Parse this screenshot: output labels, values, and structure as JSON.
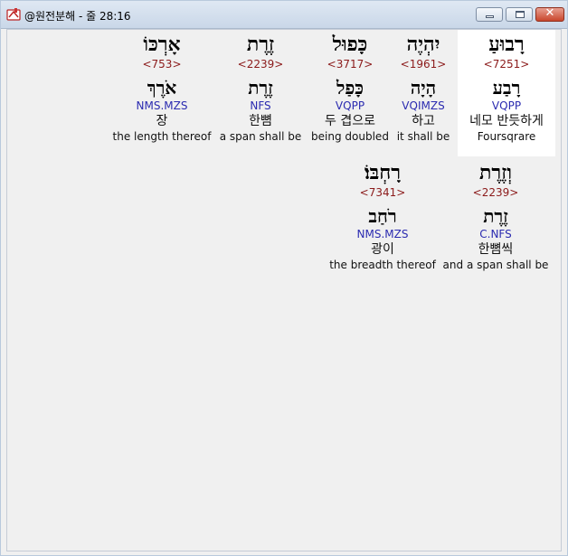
{
  "window": {
    "title": "@원전분해 - 줄 28:16",
    "icon": "app-book-icon",
    "minimize_label": "",
    "maximize_label": "",
    "close_label": "✕"
  },
  "row1": [
    {
      "hebrew": "רָבוּעַ",
      "strong": "<7251>",
      "lemma": "רָבַע",
      "morph": "VQPP",
      "korean": "네모 반듯하게",
      "english": "Foursqrare"
    },
    {
      "hebrew": "יִהְיֶה",
      "strong": "<1961>",
      "lemma": "הָיָה",
      "morph": "VQIMZS",
      "korean": "하고",
      "english": "it shall be"
    },
    {
      "hebrew": "כָּפוּל",
      "strong": "<3717>",
      "lemma": "כָּפַל",
      "morph": "VQPP",
      "korean": "두 겹으로",
      "english": "being doubled"
    },
    {
      "hebrew": "זֶרֶת",
      "strong": "<2239>",
      "lemma": "זֶרֶת",
      "morph": "NFS",
      "korean": "한뼘",
      "english": "a span shall be"
    },
    {
      "hebrew": "אָרְכּוֹ",
      "strong": "<753>",
      "lemma": "אֹרֶךְ",
      "morph": "NMS.MZS",
      "korean": "장",
      "english": "the length thereof"
    }
  ],
  "row2": [
    {
      "hebrew": "וְזֶרֶת",
      "strong": "<2239>",
      "lemma": "זֶרֶת",
      "morph": "C.NFS",
      "korean": "한뼘씩",
      "english": "and a span shall be"
    },
    {
      "hebrew": "רָחְבּוֹ׃",
      "strong": "<7341>",
      "lemma": "רֹחַב",
      "morph": "NMS.MZS",
      "korean": "광이",
      "english": "the breadth thereof"
    }
  ]
}
